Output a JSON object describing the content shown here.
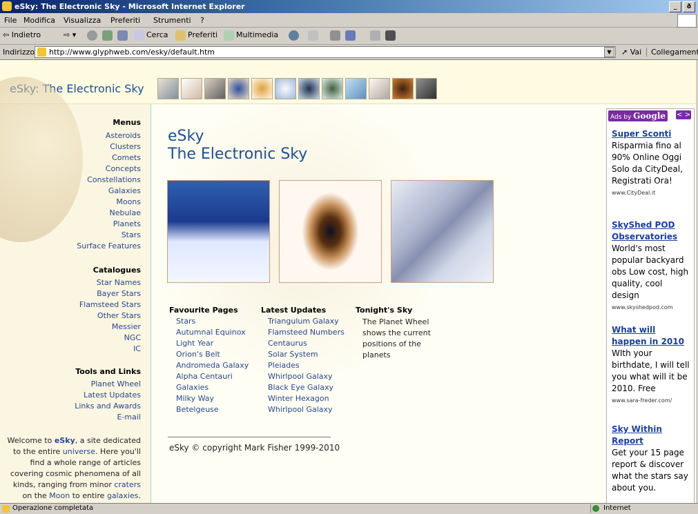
{
  "window": {
    "title": "eSky: The Electronic Sky - Microsoft Internet Explorer",
    "buttons": [
      "_",
      "ð",
      "×"
    ]
  },
  "menu": [
    "File",
    "Modifica",
    "Visualizza",
    "Preferiti",
    "Strumenti",
    "?"
  ],
  "toolbar": {
    "back": "⇦ Indietro",
    "search": "Cerca",
    "favorites": "Preferiti",
    "media": "Multimedia"
  },
  "address": {
    "label": "Indirizzo",
    "url": "http://www.glyphweb.com/esky/default.htm",
    "go": "Vai",
    "links": "Collegamenti"
  },
  "site": {
    "title": "eSky: The Electronic Sky"
  },
  "left": {
    "menus_title": "Menus",
    "menus": [
      "Asteroids",
      "Clusters",
      "Comets",
      "Concepts",
      "Constellations",
      "Galaxies",
      "Moons",
      "Nebulae",
      "Planets",
      "Stars",
      "Surface Features"
    ],
    "catalogues_title": "Catalogues",
    "catalogues": [
      "Star Names",
      "Bayer Stars",
      "Flamsteed Stars",
      "Other Stars",
      "Messier",
      "NGC",
      "IC"
    ],
    "tools_title": "Tools and Links",
    "tools": [
      "Planet Wheel",
      "Latest Updates",
      "Links and Awards",
      "E-mail"
    ],
    "welcome": {
      "pre": "Welcome to ",
      "esky": "eSky",
      "mid1": ", a site dedicated to the entire ",
      "universe": "universe",
      "mid2": ". Here you'll find a whole range of articles covering cosmic phenomena of all kinds, ranging from minor ",
      "craters": "craters",
      "mid3": " on the ",
      "moon": "Moon",
      "mid4": " to entire ",
      "galaxies": "galaxies",
      "end": "."
    }
  },
  "main": {
    "title_line1": "eSky",
    "title_line2": "The Electronic Sky",
    "fav_title": "Favourite Pages",
    "favourites": [
      "Stars",
      "Autumnal Equinox",
      "Light Year",
      "Orion's Belt",
      "Andromeda Galaxy",
      "Alpha Centauri",
      "Galaxies",
      "Milky Way",
      "Betelgeuse"
    ],
    "updates_title": "Latest Updates",
    "updates": [
      "Triangulum Galaxy",
      "Flamsteed Numbers",
      "Centaurus",
      "Solar System",
      "Pleiades",
      "Whirlpool Galaxy",
      "Black Eye Galaxy",
      "Winter Hexagon",
      "Whirlpool Galaxy"
    ],
    "tonight_title": "Tonight's Sky",
    "tonight_text": "The Planet Wheel shows the current positions of the planets",
    "copyright": "eSky © copyright Mark Fisher 1999-2010"
  },
  "ads": {
    "header_ads_by": "Ads by ",
    "header_google": "Google",
    "arrows": "< >",
    "items": [
      {
        "title": "Super Sconti",
        "text": "Risparmia fino al 90% Online Oggi Solo da CityDeal, Registrati Ora!",
        "url": "www.CityDeal.it"
      },
      {
        "title": "SkyShed POD Observatories",
        "text": "World's most popular backyard obs Low cost, high quality, cool design",
        "url": "www.skyshedpod.com"
      },
      {
        "title": "What will happen in 2010",
        "text": "WIth your birthdate, I will tell you what will it be 2010. Free",
        "url": "www.sara-freder.com/"
      },
      {
        "title": "Sky Within Report",
        "text": "Get your 15 page report & discover what the stars say about you.",
        "url": ""
      }
    ]
  },
  "status": {
    "text": "Operazione completata",
    "zone": "Internet"
  }
}
